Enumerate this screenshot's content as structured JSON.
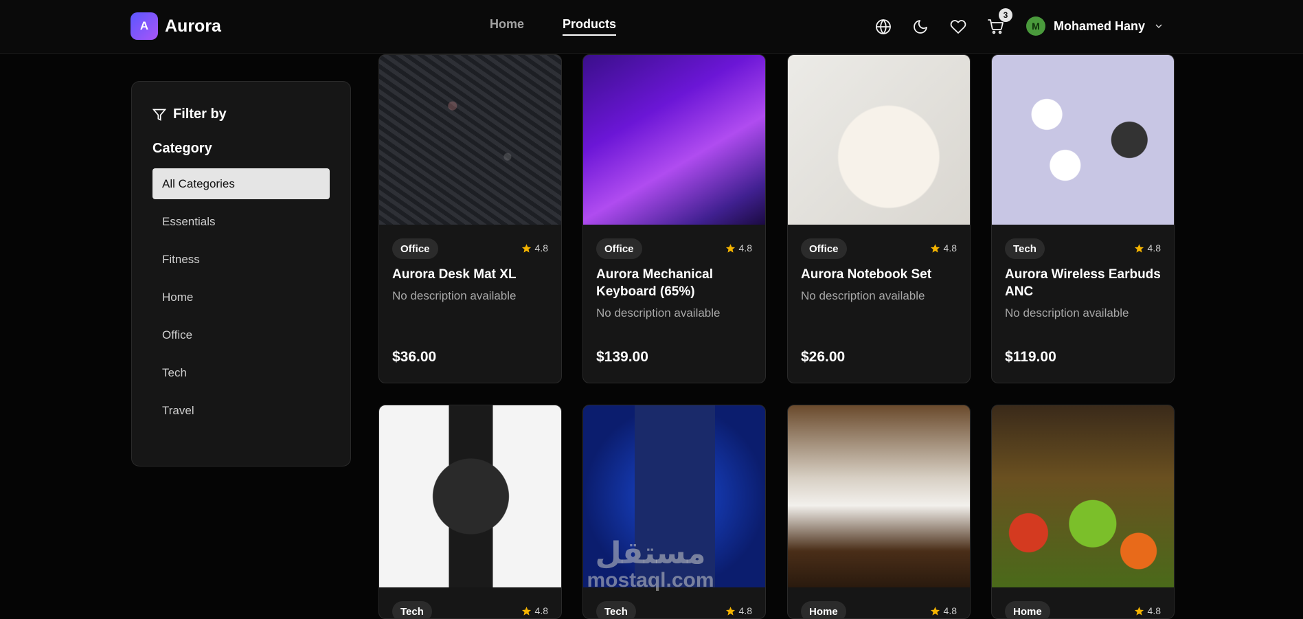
{
  "brand": {
    "logo_letter": "A",
    "name": "Aurora"
  },
  "nav": {
    "items": [
      {
        "label": "Home",
        "active": false
      },
      {
        "label": "Products",
        "active": true
      }
    ]
  },
  "header": {
    "icons": [
      "globe-icon",
      "moon-icon",
      "heart-icon",
      "cart-icon"
    ],
    "cart_count": "3",
    "user": {
      "initial": "M",
      "name": "Mohamed Hany"
    }
  },
  "sidebar": {
    "filter_title": "Filter by",
    "category_title": "Category",
    "categories": [
      {
        "label": "All Categories",
        "selected": true
      },
      {
        "label": "Essentials",
        "selected": false
      },
      {
        "label": "Fitness",
        "selected": false
      },
      {
        "label": "Home",
        "selected": false
      },
      {
        "label": "Office",
        "selected": false
      },
      {
        "label": "Tech",
        "selected": false
      },
      {
        "label": "Travel",
        "selected": false
      }
    ]
  },
  "products": [
    {
      "category": "Office",
      "rating": "4.8",
      "name": "Aurora Desk Mat XL",
      "description": "No description available",
      "price": "$36.00"
    },
    {
      "category": "Office",
      "rating": "4.8",
      "name": "Aurora Mechanical Keyboard (65%)",
      "description": "No description available",
      "price": "$139.00"
    },
    {
      "category": "Office",
      "rating": "4.8",
      "name": "Aurora Notebook Set",
      "description": "No description available",
      "price": "$26.00"
    },
    {
      "category": "Tech",
      "rating": "4.8",
      "name": "Aurora Wireless Earbuds ANC",
      "description": "No description available",
      "price": "$119.00"
    },
    {
      "category": "Tech",
      "rating": "4.8"
    },
    {
      "category": "Tech",
      "rating": "4.8"
    },
    {
      "category": "Home",
      "rating": "4.8"
    },
    {
      "category": "Home",
      "rating": "4.8"
    }
  ],
  "watermark": {
    "arabic": "مستقل",
    "latin": "mostaql.com"
  },
  "colors": {
    "background": "#050505",
    "card": "#161616",
    "star": "#f5b400",
    "logo_gradient": [
      "#5b57ff",
      "#a855f7"
    ]
  }
}
